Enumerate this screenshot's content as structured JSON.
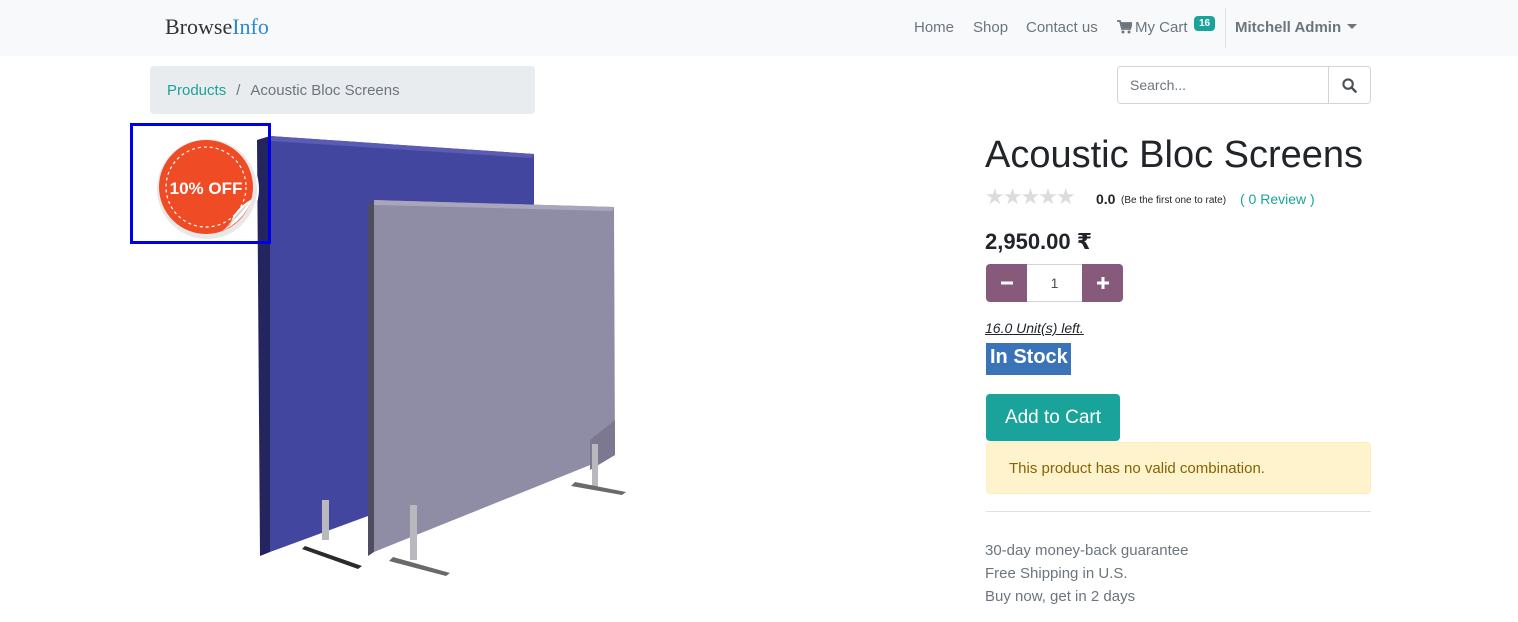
{
  "header": {
    "brand_part1": "Browse",
    "brand_part2": "Info",
    "nav": {
      "home": "Home",
      "shop": "Shop",
      "contact": "Contact us",
      "cart": "My Cart",
      "cart_count": "16",
      "user": "Mitchell Admin"
    }
  },
  "breadcrumb": {
    "link": "Products",
    "separator": "/",
    "current": "Acoustic Bloc Screens"
  },
  "search": {
    "placeholder": "Search..."
  },
  "product": {
    "sale_label": "10% OFF",
    "title": "Acoustic Bloc Screens",
    "stars": "★★★★★",
    "rating_value": "0.0",
    "rating_note": "(Be the first one to rate)",
    "review_link": "( 0 Review )",
    "price": "2,950.00 ₹",
    "quantity": "1",
    "units_left": "16.0 Unit(s) left.",
    "stock_status": "In Stock",
    "add_to_cart": "Add to Cart",
    "combination_alert": "This product has no valid combination.",
    "benefits": [
      "30-day money-back guarantee",
      "Free Shipping in U.S.",
      "Buy now, get in 2 days"
    ]
  },
  "colors": {
    "accent": "#1aa39a",
    "qty_buttons": "#875a7b",
    "stock_badge": "#3b73b9",
    "sale_red": "#ef4b24",
    "highlight_box": "#0000e6"
  }
}
